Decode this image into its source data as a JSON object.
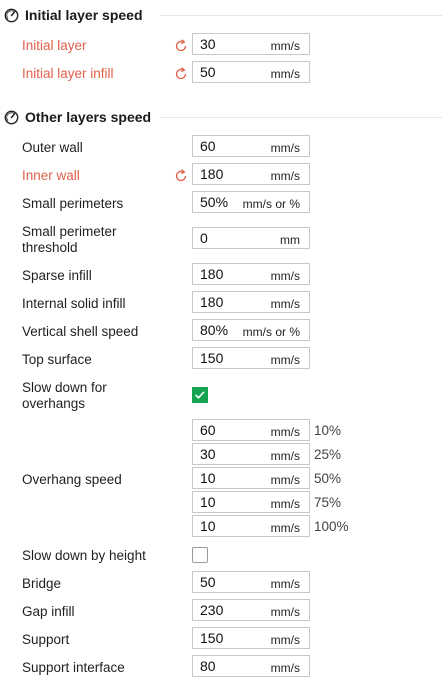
{
  "initial": {
    "title": "Initial layer speed",
    "rows": [
      {
        "label": "Initial layer",
        "value": "30",
        "unit": "mm/s"
      },
      {
        "label": "Initial layer infill",
        "value": "50",
        "unit": "mm/s"
      }
    ]
  },
  "other": {
    "title": "Other layers speed",
    "outer_wall": {
      "label": "Outer wall",
      "value": "60",
      "unit": "mm/s"
    },
    "inner_wall": {
      "label": "Inner wall",
      "value": "180",
      "unit": "mm/s"
    },
    "small_perimeters": {
      "label": "Small perimeters",
      "value": "50%",
      "unit": "mm/s or %"
    },
    "small_perimeter_threshold": {
      "label": "Small perimeter threshold",
      "value": "0",
      "unit": "mm"
    },
    "sparse_infill": {
      "label": "Sparse infill",
      "value": "180",
      "unit": "mm/s"
    },
    "internal_solid_infill": {
      "label": "Internal solid infill",
      "value": "180",
      "unit": "mm/s"
    },
    "vertical_shell_speed": {
      "label": "Vertical shell speed",
      "value": "80%",
      "unit": "mm/s or %"
    },
    "top_surface": {
      "label": "Top surface",
      "value": "150",
      "unit": "mm/s"
    },
    "slow_down_overhangs": {
      "label": "Slow down for overhangs",
      "checked": true
    },
    "overhang_speed": {
      "label": "Overhang speed",
      "rows": [
        {
          "value": "60",
          "unit": "mm/s",
          "pct": "10%"
        },
        {
          "value": "30",
          "unit": "mm/s",
          "pct": "25%"
        },
        {
          "value": "10",
          "unit": "mm/s",
          "pct": "50%"
        },
        {
          "value": "10",
          "unit": "mm/s",
          "pct": "75%"
        },
        {
          "value": "10",
          "unit": "mm/s",
          "pct": "100%"
        }
      ]
    },
    "slow_down_height": {
      "label": "Slow down by height",
      "checked": false
    },
    "bridge": {
      "label": "Bridge",
      "value": "50",
      "unit": "mm/s"
    },
    "gap_infill": {
      "label": "Gap infill",
      "value": "230",
      "unit": "mm/s"
    },
    "support": {
      "label": "Support",
      "value": "150",
      "unit": "mm/s"
    },
    "support_interface": {
      "label": "Support interface",
      "value": "80",
      "unit": "mm/s"
    }
  },
  "colors": {
    "modified": "#e0604a",
    "checkbox": "#15a350"
  },
  "icons": {
    "section": "gauge-icon",
    "reset": "reset-arrow-icon",
    "check": "checkmark-icon"
  }
}
